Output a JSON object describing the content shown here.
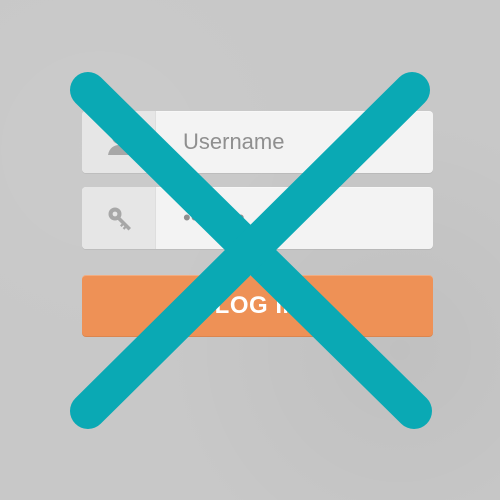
{
  "colors": {
    "background": "#c9c9c9",
    "field_bg": "#f3f3f3",
    "icon_cell_bg": "#e6e6e6",
    "button_bg": "#ee9156",
    "overlay_x": "#0aa9b4"
  },
  "form": {
    "username": {
      "placeholder": "Username",
      "icon": "user-icon"
    },
    "password": {
      "value": "********",
      "icon": "key-icon"
    },
    "login_label": "LOG IN"
  },
  "overlay": {
    "icon": "x-cross-icon"
  }
}
